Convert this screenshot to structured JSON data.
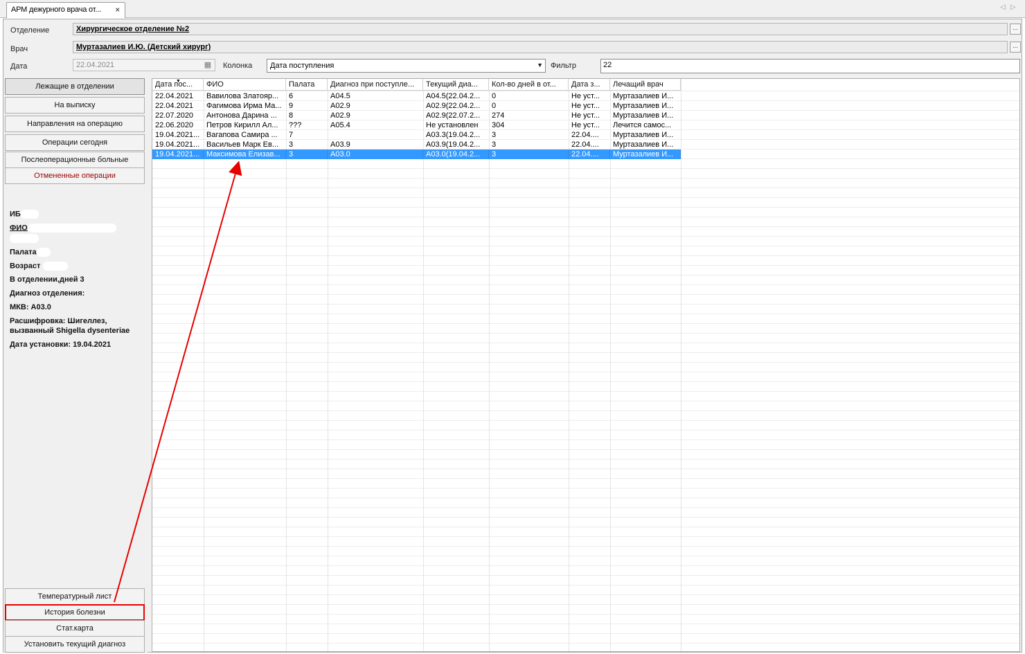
{
  "tab": {
    "title": "АРМ дежурного врача от...",
    "close": "×"
  },
  "tabnav": {
    "left": "◁",
    "right": "▷"
  },
  "form": {
    "department_label": "Отделение",
    "department_value": "Хирургическое отделение №2",
    "doctor_label": "Врач",
    "doctor_value": "Муртазалиев И.Ю. (Детский хирург)",
    "date_label": "Дата",
    "date_value": "22.04.2021",
    "column_label": "Колонка",
    "column_value": "Дата поступления",
    "filter_label": "Фильтр",
    "filter_value": "22",
    "ellipsis": "..."
  },
  "nav_buttons": [
    "Лежащие в отделении",
    "На выписку",
    "Направления на операцию",
    "Операции сегодня",
    "Послеоперационные больные",
    "Отмененные операции"
  ],
  "patient_info": {
    "ib_label": "ИБ",
    "fio_label": "ФИО",
    "ward_label": "Палата",
    "age_label": "Возраст",
    "days": "В отделении,дней 3",
    "diag_label": "Диагноз отделения:",
    "mkb": "МКВ: A03.0",
    "decode_1": "Расшифровка: Шигеллез,",
    "decode_2": "вызванный Shigella dysenteriae",
    "set_date": "Дата установки: 19.04.2021"
  },
  "bottom_buttons": [
    "Температурный лист",
    "История болезни",
    "Стат.карта",
    "Установить текущий диагноз"
  ],
  "grid": {
    "columns": [
      "Дата пос...",
      "ФИО",
      "Палата",
      "Диагноз при поступле...",
      "Текущий диа...",
      "Кол-во дней в от...",
      "Дата з...",
      "Лечащий врач"
    ],
    "rows": [
      [
        "22.04.2021",
        "Вавилова Златояр...",
        "6",
        "A04.5",
        "A04.5(22.04.2...",
        "0",
        "Не уст...",
        "Муртазалиев И..."
      ],
      [
        "22.04.2021",
        "Фагимова Ирма Ма...",
        "9",
        "A02.9",
        "A02.9(22.04.2...",
        "0",
        "Не уст...",
        "Муртазалиев И..."
      ],
      [
        "22.07.2020",
        "Антонова Дарина ...",
        "8",
        "A02.9",
        "A02.9(22.07.2...",
        "274",
        "Не уст...",
        "Муртазалиев И..."
      ],
      [
        "22.06.2020",
        "Петров Кирилл Ал...",
        "???",
        "A05.4",
        "Не установлен",
        "304",
        "Не уст...",
        "Лечится самос..."
      ],
      [
        "19.04.2021...",
        "Вагапова Самира ...",
        "7",
        "",
        "A03.3(19.04.2...",
        "3",
        "22.04....",
        "Муртазалиев И..."
      ],
      [
        "19.04.2021...",
        "Васильев Марк Ев...",
        "3",
        "A03.9",
        "A03.9(19.04.2...",
        "3",
        "22.04....",
        "Муртазалиев И..."
      ],
      [
        "19.04.2021...",
        "Максимова Елизав...",
        "3",
        "A03.0",
        "A03.0(19.04.2...",
        "3",
        "22.04....",
        "Муртазалиев И..."
      ]
    ],
    "selected_row": 6
  },
  "colors": {
    "selection": "#3399ff",
    "annotation": "#e60000",
    "cancelled_text": "#9a0000"
  }
}
